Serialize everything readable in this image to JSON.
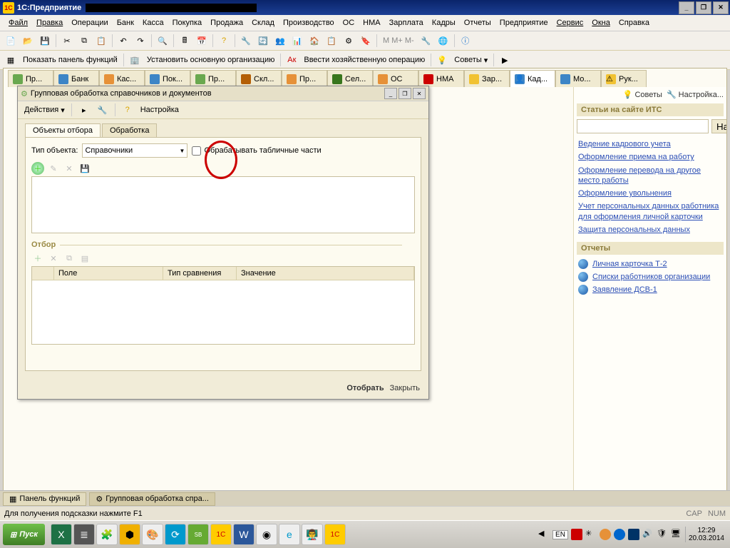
{
  "titlebar": {
    "app": "1С:Предприятие"
  },
  "menu": [
    "Файл",
    "Правка",
    "Операции",
    "Банк",
    "Касса",
    "Покупка",
    "Продажа",
    "Склад",
    "Производство",
    "ОС",
    "НМА",
    "Зарплата",
    "Кадры",
    "Отчеты",
    "Предприятие",
    "Сервис",
    "Окна",
    "Справка"
  ],
  "toolbar2": {
    "show_panel": "Показать панель функций",
    "set_org": "Установить основную организацию",
    "enter_op": "Ввести хозяйственную операцию",
    "advice": "Советы"
  },
  "doctabs": [
    "Пр...",
    "Банк",
    "Кас...",
    "Пок...",
    "Пр...",
    "Скл...",
    "Пр...",
    "Сел...",
    "ОС",
    "НМА",
    "Зар...",
    "Кад...",
    "Мо...",
    "Рук..."
  ],
  "doctab_active": 11,
  "rightpanel": {
    "advice": "Советы",
    "settings": "Настройка...",
    "its_header": "Статьи на сайте ИТС",
    "find": "Найти",
    "links": [
      "Ведение кадрового учета",
      "Оформление приема на работу",
      "Оформление перевода на другое место работы",
      "Оформление увольнения",
      "Учет персональных данных работника для оформления личной карточки",
      "Защита персональных данных"
    ],
    "reports_header": "Отчеты",
    "reports": [
      "Личная карточка Т-2",
      "Списки работников организации",
      "Заявление ДСВ-1"
    ]
  },
  "dialog": {
    "title": "Групповая обработка справочников и документов",
    "actions": "Действия",
    "settings": "Настройка",
    "tab1": "Объекты отбора",
    "tab2": "Обработка",
    "type_label": "Тип объекта:",
    "type_value": "Справочники",
    "checkbox": "Обрабатывать табличные части",
    "filter": "Отбор",
    "col_field": "Поле",
    "col_cmp": "Тип сравнения",
    "col_val": "Значение",
    "select": "Отобрать",
    "close": "Закрыть"
  },
  "apptaskbar": {
    "panel": "Панель функций",
    "dialog": "Групповая обработка спра..."
  },
  "status": {
    "hint": "Для получения подсказки нажмите F1",
    "cap": "CAP",
    "num": "NUM"
  },
  "system": {
    "start": "Пуск",
    "lang": "EN",
    "time": "12:29",
    "date": "20.03.2014"
  }
}
